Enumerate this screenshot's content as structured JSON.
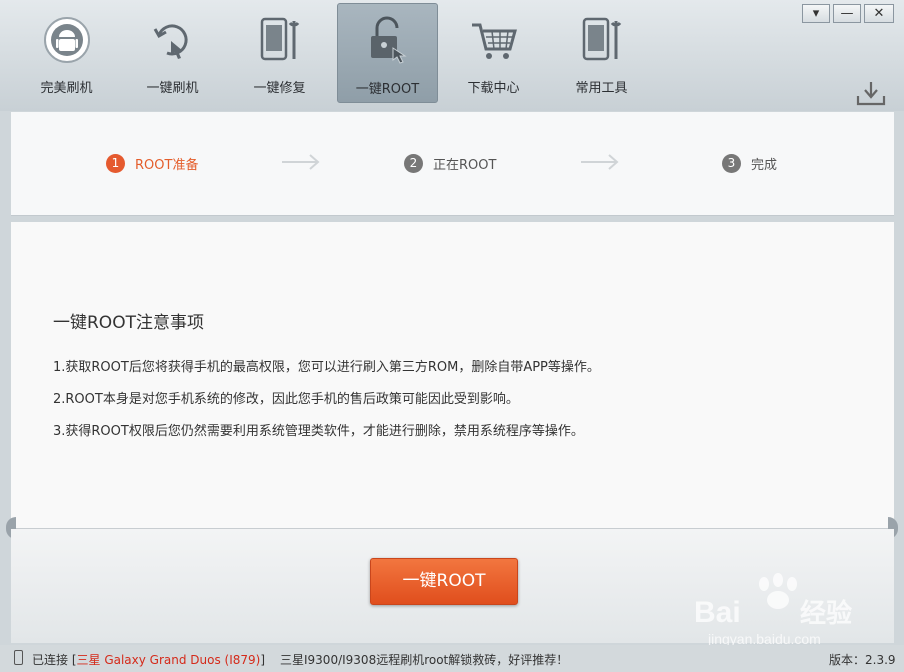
{
  "nav": {
    "items": [
      {
        "label": "完美刷机",
        "icon": "android-sync-icon"
      },
      {
        "label": "一键刷机",
        "icon": "touch-refresh-icon"
      },
      {
        "label": "一键修复",
        "icon": "phone-wrench-icon"
      },
      {
        "label": "一键ROOT",
        "icon": "unlock-icon",
        "active": true
      },
      {
        "label": "下载中心",
        "icon": "shopping-cart-icon"
      },
      {
        "label": "常用工具",
        "icon": "phone-tools-icon"
      }
    ]
  },
  "window_controls": {
    "menu": "▾",
    "minimize": "—",
    "close": "✕"
  },
  "steps": [
    {
      "num": "1",
      "label": "ROOT准备",
      "current": true
    },
    {
      "num": "2",
      "label": "正在ROOT"
    },
    {
      "num": "3",
      "label": "完成"
    }
  ],
  "notes": {
    "title": "一键ROOT注意事项",
    "items": [
      "1.获取ROOT后您将获得手机的最高权限，您可以进行刷入第三方ROM，删除自带APP等操作。",
      "2.ROOT本身是对您手机系统的修改，因此您手机的售后政策可能因此受到影响。",
      "3.获得ROOT权限后您仍然需要利用系统管理类软件，才能进行删除，禁用系统程序等操作。"
    ]
  },
  "root_button": "一键ROOT",
  "status": {
    "connected_prefix": "已连接 [",
    "device": "三星 Galaxy Grand Duos (I879)",
    "connected_suffix": "]",
    "promo": "三星I9300/I9308远程刷机root解锁救砖，好评推荐！",
    "version": "版本：2.3.9"
  },
  "watermark": {
    "brand": "Baidu",
    "product": "经验",
    "url": "jingyan.baidu.com"
  },
  "colors": {
    "accent": "#e55a2f",
    "device_text": "#d42a1a"
  }
}
